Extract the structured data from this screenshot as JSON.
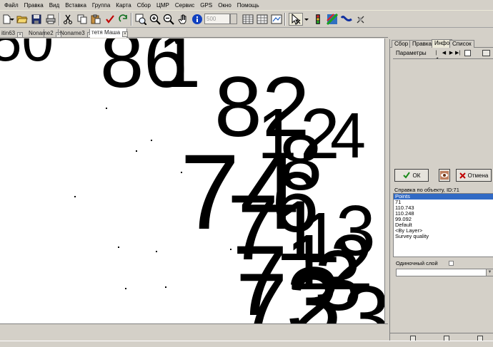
{
  "menu": {
    "items": [
      "Файл",
      "Правка",
      "Вид",
      "Вставка",
      "Группа",
      "Карта",
      "Сбор",
      "ЦМР",
      "Сервис",
      "GPS",
      "Окно",
      "Помощь"
    ]
  },
  "toolbar": {
    "scale_value": "500",
    "icons": [
      "new-icon",
      "open-icon",
      "save-icon",
      "print-icon",
      "cut-icon",
      "copy-icon",
      "paste-icon",
      "check-icon",
      "redo-icon",
      "zoom-extent-icon",
      "zoom-in-icon",
      "zoom-out-icon",
      "pan-hand-icon",
      "info-icon",
      "table-icon",
      "table-grid-icon",
      "map-icon",
      "select-tool-icon",
      "traffic-light-icon",
      "layers-icon",
      "curve-icon",
      "satellite-icon"
    ]
  },
  "doc_tabs": [
    {
      "label": "itin63",
      "active": false
    },
    {
      "label": "Noname2",
      "active": false
    },
    {
      "label": "Noname3",
      "active": false
    },
    {
      "label": "тетя Маша",
      "active": true
    }
  ],
  "map": {
    "glyphs": [
      {
        "text": "50",
        "size": 80
      },
      {
        "text": "86",
        "size": 110
      },
      {
        "text": "1",
        "size": 110
      },
      {
        "text": "82",
        "size": 120
      },
      {
        "text": "1",
        "size": 100
      },
      {
        "text": "2",
        "size": 100
      },
      {
        "text": "4",
        "size": 90
      },
      {
        "text": "74",
        "size": 150
      },
      {
        "text": "8",
        "size": 110
      },
      {
        "text": "6",
        "size": 120
      },
      {
        "text": "3",
        "size": 70
      },
      {
        "text": "7",
        "size": 130
      },
      {
        "text": "1",
        "size": 120
      },
      {
        "text": "1",
        "size": 100
      },
      {
        "text": "3",
        "size": 100
      },
      {
        "text": "7",
        "size": 140
      },
      {
        "text": "12",
        "size": 110
      },
      {
        "text": "3",
        "size": 120
      },
      {
        "text": "72",
        "size": 130
      },
      {
        "text": "3",
        "size": 140
      },
      {
        "text": "3",
        "size": 120
      }
    ]
  },
  "panel": {
    "tabs": [
      {
        "label": "Сбор",
        "active": false
      },
      {
        "label": "Правка",
        "active": false
      },
      {
        "label": "Инфо",
        "active": true
      },
      {
        "label": "Список",
        "active": false
      }
    ],
    "params_label": "Параметры",
    "nav": [
      "|◀",
      "◀",
      "▶",
      "▶|"
    ],
    "ok_label": "ОК",
    "cancel_label": "Отмена",
    "info_title": "Справка по объекту, ID:71",
    "info_rows": [
      "Points",
      "71",
      "110.743",
      "110.248",
      "99.092",
      "Default",
      "<By Layer>",
      "Survey quality"
    ],
    "single_layer_label": "Одиночный слой"
  },
  "colors": {
    "ok_check": "#1a8a1a",
    "cancel_x": "#c00000",
    "selection": "#316ac5"
  }
}
